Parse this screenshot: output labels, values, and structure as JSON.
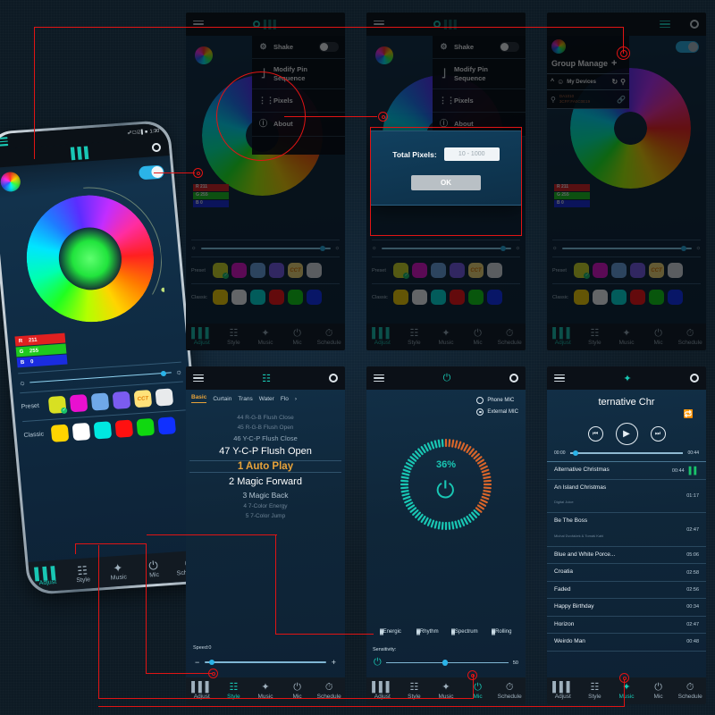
{
  "phone": {
    "status_time": "1:30",
    "appbar_icon": "equalizer-icon",
    "rgb": {
      "r_label": "R",
      "r_value": "211",
      "g_label": "G",
      "g_value": "255",
      "b_label": "B",
      "b_value": "0"
    },
    "preset_label": "Preset",
    "classic_label": "Classic",
    "preset_swatches": [
      "#d8e022",
      "#e910d0",
      "#6fa8e8",
      "#7b5cf0",
      "CCT",
      "#e8eaec"
    ],
    "classic_swatches": [
      "#ffd400",
      "#ffffff",
      "#00e8e0",
      "#ff1010",
      "#10d810",
      "#1030ff"
    ],
    "cct_label": "CCT",
    "nav": [
      {
        "label": "Adjust",
        "icon": "sliders-icon",
        "active": true
      },
      {
        "label": "Style",
        "icon": "grid-icon",
        "active": false
      },
      {
        "label": "Music",
        "icon": "music-note-icon",
        "active": false
      },
      {
        "label": "Mic",
        "icon": "microphone-icon",
        "active": false
      },
      {
        "label": "Schedule",
        "icon": "clock-icon",
        "active": false
      }
    ]
  },
  "panel_menu": {
    "menu_icon": "hamburger-icon",
    "title_icon": "power-icon",
    "items": [
      {
        "label": "Shake",
        "icon": "shake-icon",
        "toggle": true,
        "toggle_on": false
      },
      {
        "label": "Modify Pin Sequence",
        "icon": "pin-sequence-icon",
        "toggle": false
      },
      {
        "label": "Pixels",
        "icon": "pixels-icon",
        "toggle": false
      },
      {
        "label": "About",
        "icon": "info-icon",
        "toggle": false
      }
    ],
    "rgb": {
      "r_label": "R",
      "r_value": "211",
      "g_label": "G",
      "g_value": "255",
      "b_label": "B",
      "b_value": "0"
    },
    "preset_label": "Preset",
    "classic_label": "Classic",
    "cct_label": "CCT",
    "nav": [
      {
        "label": "Adjust",
        "icon": "sliders-icon",
        "active": true
      },
      {
        "label": "Style",
        "icon": "grid-icon",
        "active": false
      },
      {
        "label": "Music",
        "icon": "music-note-icon",
        "active": false
      },
      {
        "label": "Mic",
        "icon": "microphone-icon",
        "active": false
      },
      {
        "label": "Schedule",
        "icon": "clock-icon",
        "active": false
      }
    ]
  },
  "panel_dialog": {
    "dialog": {
      "label": "Total Pixels:",
      "input_value": "",
      "input_placeholder": "10 - 1000",
      "ok_label": "OK"
    }
  },
  "panel_group": {
    "title": "Group Manage",
    "add_label": "+",
    "devices_label": "My Devices",
    "device_name": "DA1010",
    "device_mac": "3CFF:FA0C0E19",
    "refresh_icon": "refresh-icon",
    "search_icon": "search-bulb-icon",
    "link_icon": "link-icon"
  },
  "panel_style": {
    "title_icon": "grid-icon",
    "tabs": [
      {
        "label": "Basic",
        "active": true
      },
      {
        "label": "Curtain",
        "active": false
      },
      {
        "label": "Trans",
        "active": false
      },
      {
        "label": "Water",
        "active": false
      },
      {
        "label": "Flo",
        "active": false
      }
    ],
    "tab_more": "›",
    "effects": [
      {
        "label": "44 R-G-B Flush Close",
        "style": "f1"
      },
      {
        "label": "45 R-G-B Flush Open",
        "style": "f1"
      },
      {
        "label": "46 Y-C-P Flush Close",
        "style": "f2"
      },
      {
        "label": "47 Y-C-P Flush Open",
        "style": "f3"
      },
      {
        "label": "1 Auto Play",
        "style": "f4"
      },
      {
        "label": "2 Magic Forward",
        "style": "f5"
      },
      {
        "label": "3 Magic Back",
        "style": "f6"
      },
      {
        "label": "4 7-Color Energy",
        "style": "f1"
      },
      {
        "label": "5 7-Color Jump",
        "style": "f1"
      }
    ],
    "speed_label": "Speed:0",
    "minus": "−",
    "plus": "+",
    "nav": [
      {
        "label": "Adjust",
        "icon": "sliders-icon",
        "active": false
      },
      {
        "label": "Style",
        "icon": "grid-icon",
        "active": true
      },
      {
        "label": "Music",
        "icon": "music-note-icon",
        "active": false
      },
      {
        "label": "Mic",
        "icon": "microphone-icon",
        "active": false
      },
      {
        "label": "Schedule",
        "icon": "clock-icon",
        "active": false
      }
    ]
  },
  "panel_mic": {
    "title_icon": "microphone-wave-icon",
    "sources": [
      {
        "label": "Phone MIC",
        "selected": false
      },
      {
        "label": "External MIC",
        "selected": true
      }
    ],
    "level_percent": "36%",
    "mic_icon": "microphone-icon",
    "modes": [
      {
        "label": "Energic",
        "selected": false
      },
      {
        "label": "Rhythm",
        "selected": false
      },
      {
        "label": "Spectrum",
        "selected": false
      },
      {
        "label": "Rolling",
        "selected": true
      }
    ],
    "sensitivity_label": "Sensitivity:",
    "sensitivity_value": "50",
    "nav": [
      {
        "label": "Adjust",
        "icon": "sliders-icon",
        "active": false
      },
      {
        "label": "Style",
        "icon": "grid-icon",
        "active": false
      },
      {
        "label": "Music",
        "icon": "music-note-icon",
        "active": false
      },
      {
        "label": "Mic",
        "icon": "microphone-icon",
        "active": true
      },
      {
        "label": "Schedule",
        "icon": "clock-icon",
        "active": false
      }
    ]
  },
  "panel_music": {
    "title_icon": "music-note-icon",
    "now_playing": "ternative Chr",
    "loop_icon": "repeat-icon",
    "prev_icon": "previous-icon",
    "play_icon": "play-icon",
    "next_icon": "next-icon",
    "elapsed": "00:00",
    "duration": "00:44",
    "tracks": [
      {
        "name": "Alternative Christmas",
        "artist": "",
        "duration": "00:44",
        "playing": true
      },
      {
        "name": "An Island Christmas",
        "artist": "Digital Juice",
        "duration": "01:17",
        "playing": false
      },
      {
        "name": "Be The Boss",
        "artist": "Michal Dvořáček & Tomáš Kahl",
        "duration": "02:47",
        "playing": false
      },
      {
        "name": "Blue and White Porce...",
        "artist": "",
        "duration": "05:06",
        "playing": false
      },
      {
        "name": "Croatia",
        "artist": "",
        "duration": "02:58",
        "playing": false
      },
      {
        "name": "Faded",
        "artist": "",
        "duration": "02:56",
        "playing": false
      },
      {
        "name": "Happy Birthday",
        "artist": "",
        "duration": "00:34",
        "playing": false
      },
      {
        "name": "Horizon",
        "artist": "",
        "duration": "02:47",
        "playing": false
      },
      {
        "name": "Weirdo Man",
        "artist": "",
        "duration": "00:48",
        "playing": false
      }
    ],
    "nav": [
      {
        "label": "Adjust",
        "icon": "sliders-icon",
        "active": false
      },
      {
        "label": "Style",
        "icon": "grid-icon",
        "active": false
      },
      {
        "label": "Music",
        "icon": "music-note-icon",
        "active": true
      },
      {
        "label": "Mic",
        "icon": "microphone-icon",
        "active": false
      },
      {
        "label": "Schedule",
        "icon": "clock-icon",
        "active": false
      }
    ]
  },
  "colors": {
    "accent": "#19c7b4",
    "highlight": "#e8a33a",
    "annotation": "#e11414",
    "background": "#0d1a24"
  }
}
